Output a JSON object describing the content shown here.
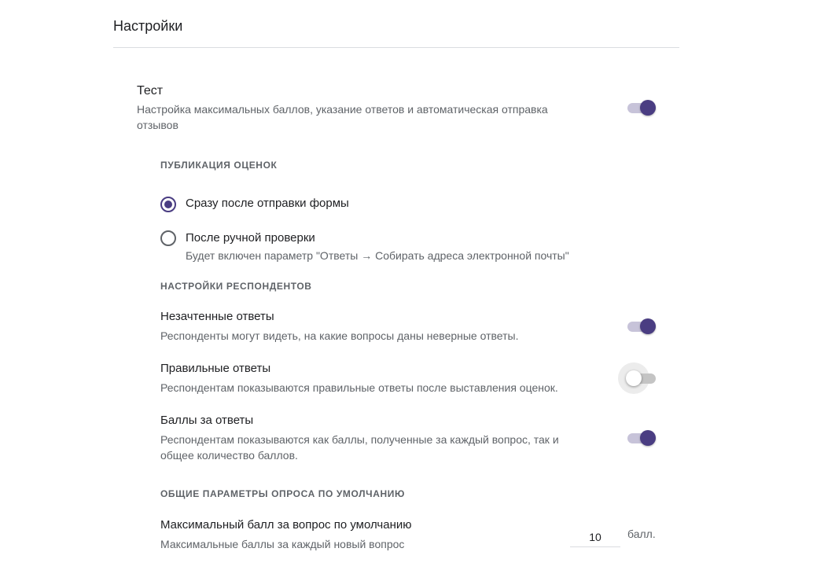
{
  "page": {
    "title": "Настройки"
  },
  "quiz": {
    "title": "Тест",
    "description_line1": "Настройка максимальных баллов, указание ответов и автоматическая отправка",
    "description_line2": "отзывов",
    "enabled": true
  },
  "grade_release": {
    "heading": "ПУБЛИКАЦИЯ ОЦЕНОК",
    "options": [
      {
        "label": "Сразу после отправки формы",
        "selected": true
      },
      {
        "label": "После ручной проверки",
        "hint": "Будет включен параметр \"Ответы → Собирать адреса электронной почты\"",
        "selected": false
      }
    ]
  },
  "respondent_settings": {
    "heading": "НАСТРОЙКИ РЕСПОНДЕНТОВ",
    "items": [
      {
        "title": "Незачтенные ответы",
        "description": "Респонденты могут видеть, на какие вопросы даны неверные ответы.",
        "enabled": true
      },
      {
        "title": "Правильные ответы",
        "description": "Респондентам показываются правильные ответы после выставления оценок.",
        "enabled": false
      },
      {
        "title": "Баллы за ответы",
        "description_line1": "Респондентам показываются как баллы, полученные за каждый вопрос, так и",
        "description_line2": "общее количество баллов.",
        "enabled": true
      }
    ]
  },
  "defaults": {
    "heading": "ОБЩИЕ ПАРАМЕТРЫ ОПРОСА ПО УМОЛЧАНИЮ",
    "max_points": {
      "title": "Максимальный балл за вопрос по умолчанию",
      "description": "Максимальные баллы за каждый новый вопрос",
      "value": "10",
      "unit": "балл."
    }
  },
  "colors": {
    "accent": "#4a3d82",
    "track_on": "#c7c3d9",
    "track_off": "#c4c4c4",
    "text_primary": "#202124",
    "text_secondary": "#5f6368"
  }
}
